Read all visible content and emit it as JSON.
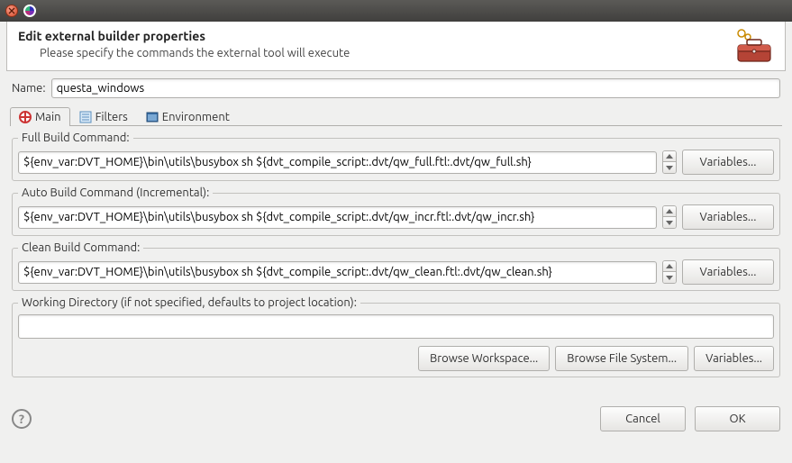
{
  "window": {
    "title": ""
  },
  "header": {
    "title": "Edit external builder properties",
    "subtitle": "Please specify the commands the external tool will execute"
  },
  "name": {
    "label": "Name:",
    "value": "questa_windows"
  },
  "tabs": [
    {
      "label": "Main"
    },
    {
      "label": "Filters"
    },
    {
      "label": "Environment"
    }
  ],
  "groups": {
    "full": {
      "legend": "Full Build Command:",
      "value": "${env_var:DVT_HOME}\\bin\\utils\\busybox sh ${dvt_compile_script:.dvt/qw_full.ftl:.dvt/qw_full.sh}",
      "vars": "Variables..."
    },
    "auto": {
      "legend": "Auto Build Command (Incremental):",
      "value": "${env_var:DVT_HOME}\\bin\\utils\\busybox sh ${dvt_compile_script:.dvt/qw_incr.ftl:.dvt/qw_incr.sh}",
      "vars": "Variables..."
    },
    "clean": {
      "legend": "Clean Build Command:",
      "value": "${env_var:DVT_HOME}\\bin\\utils\\busybox sh ${dvt_compile_script:.dvt/qw_clean.ftl:.dvt/qw_clean.sh}",
      "vars": "Variables..."
    },
    "wdir": {
      "legend": "Working Directory (if not specified, defaults to project location):",
      "value": "",
      "browse_ws": "Browse Workspace...",
      "browse_fs": "Browse File System...",
      "vars": "Variables..."
    }
  },
  "footer": {
    "cancel": "Cancel",
    "ok": "OK"
  }
}
